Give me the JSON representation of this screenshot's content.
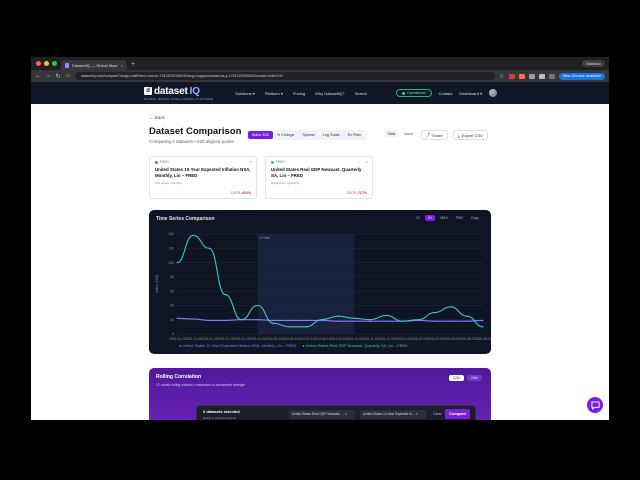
{
  "browser": {
    "tab_title": "DatasetIQ — Global Macro Int…",
    "tab_close": "×",
    "new_tab": "+",
    "profile": "Glassico",
    "url": "datasetiq.com/compare?slugs=usiflfrdlrcl-nsa-ml-1781425934593&slug=usgdpnowcast-sa-q-1781425934591&mode=index100",
    "relaunch": "New Chrome available"
  },
  "site_nav": {
    "logo": "dataset",
    "logo_suffix": "IQ",
    "logo_sub": "GLOBAL MACRO INTELLIGENCE PLATFORM",
    "links": [
      "Solutions ▾",
      "Platform ▾",
      "Pricing",
      "Why DatasetIQ?",
      "Search"
    ],
    "status": "Operational",
    "right_links": [
      "Contact",
      "Dashboard ▾"
    ]
  },
  "page": {
    "back": "← Back",
    "title": "Dataset Comparison",
    "subtitle": "Comparing 2 datasets • 526 aligned points",
    "modes": [
      "Index 100",
      "% Change",
      "Spread",
      "Log Scale",
      "Ex Filter"
    ],
    "grid_on": "Grid",
    "grid_off": "None",
    "share": "Share",
    "export": "Export CSV"
  },
  "cards": [
    {
      "source": "FRED",
      "name": "United States 10-Year Expected Inflation NSA, Monthly, Lin – FRED",
      "meta": "516 points • Monthly",
      "cagr_label": "CAGR",
      "cagr": "-40.0%",
      "color": "#7a5cff"
    },
    {
      "source": "FRED",
      "name": "United States Real GDP Nowcast, Quarterly SA, Lin – FRED",
      "meta": "8Quarters • Quarterly",
      "cagr_label": "CAGR",
      "cagr": "-72.7%",
      "color": "#2dc3c1"
    }
  ],
  "chart_panel": {
    "title": "Time Series Comparison",
    "ranges": [
      "1Y",
      "5Y",
      "MAX",
      "PNG",
      "Copy"
    ],
    "band_label": "AI Intel",
    "legend": [
      "United States 10-Year Expected Inflation NSA, Monthly, Lin – FRED",
      "United States Real GDP Nowcast, Quarterly SA, Lin – FRED"
    ]
  },
  "chart_data": {
    "type": "line",
    "ylabel": "Index (100)",
    "ylim": [
      0,
      140
    ],
    "yticks": [
      0,
      20,
      40,
      60,
      80,
      100,
      120,
      140
    ],
    "x": [
      "2023-11-01",
      "2023-12-01",
      "2024-01-01",
      "2024-02-01",
      "2024-03-01",
      "2024-04-01",
      "2024-05-01",
      "2024-06-01",
      "2024-07-01",
      "2024-08-01",
      "2024-09-01",
      "2024-10-01",
      "2024-11-01",
      "2024-12-01",
      "2025-01-01",
      "2025-02-01",
      "2025-03-01",
      "2025-04-01",
      "2025-05-01",
      "2025-06-01"
    ],
    "series": [
      {
        "name": "United States 10-Year Expected Inflation NSA, Monthly, Lin – FRED",
        "color": "#8a7bff",
        "values": [
          22,
          21,
          19,
          19,
          20,
          20,
          19,
          19,
          19,
          19,
          18,
          18,
          18,
          18,
          18,
          19,
          18,
          18,
          18,
          19
        ]
      },
      {
        "name": "United States Real GDP Nowcast, Quarterly SA, Lin – FRED",
        "color": "#35c9c4",
        "values": [
          100,
          138,
          120,
          55,
          20,
          40,
          15,
          10,
          10,
          20,
          25,
          22,
          20,
          26,
          18,
          20,
          30,
          38,
          25,
          10
        ]
      }
    ]
  },
  "correlation": {
    "title": "Rolling Correlation",
    "subtitle": "12-month rolling window • measures co-movement strength",
    "windows": [
      "12M",
      "24M"
    ]
  },
  "selection_bar": {
    "title": "2 datasets selected",
    "hint": "Ready to compare (max 4)",
    "chips": [
      "United States Real GDP Nowcast, …  ×",
      "United States 10-Year Expected In…  ×"
    ],
    "clear": "Clear",
    "compare": "Compare"
  }
}
